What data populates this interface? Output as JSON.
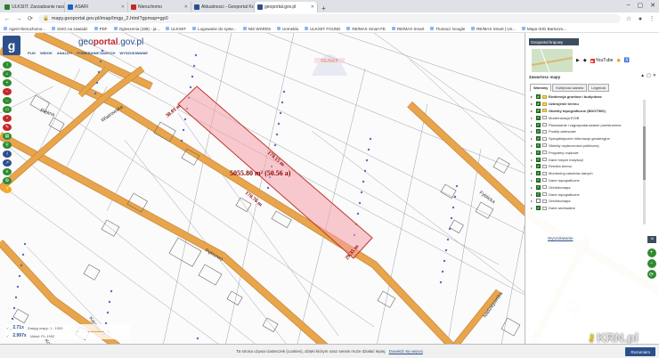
{
  "browser": {
    "tabs": [
      {
        "label": "ULKSIIT. Zarzadzanie narzedzi...",
        "color": "#2e7d32",
        "active": false
      },
      {
        "label": "ASARI",
        "color": "#1565c0",
        "active": false
      },
      {
        "label": "Nieruchomo",
        "color": "#c62828",
        "active": false
      },
      {
        "label": "Aktualnosci - Geoportal Krajowy",
        "color": "#2c4f8c",
        "active": false
      },
      {
        "label": "geoportal.gov.pl",
        "color": "#2c4f8c",
        "active": true
      }
    ],
    "new_tab": "+",
    "window_controls": [
      "–",
      "▢",
      "✕"
    ],
    "url": "mapy.geoportal.gov.pl/imap/Imgp_2.html?gpmap=gp0",
    "bookmarks": [
      "Agent Nieruchomo...",
      "SSIG na zawiadz",
      "PDF",
      "Ogloszenia (198) - ja...",
      "ULKSIIT",
      "Logowanie do syste...",
      "NIS WSRDS",
      "Unmeldu",
      "ULKSIIT FOUND",
      "RE/MAX Smart FE",
      "RE/MAX Smart",
      "Tlumacz Google",
      "RE/MAX Smart | Un...",
      "Mapa ISIG Bartoszu..."
    ]
  },
  "geoportal": {
    "logo_letter": "g",
    "brand_pre": "geo",
    "brand_mid": "portal",
    "brand_post": ".gov.pl",
    "menu": [
      "PLIK",
      "WIDOK",
      "ANALIZY",
      "POBIERANIE DANYCH",
      "WYSZUKIWANIE"
    ],
    "left_tools": [
      {
        "icon": "i-icon",
        "color": "#2e8b2e"
      },
      {
        "icon": "home-icon",
        "color": "#2e8b2e"
      },
      {
        "icon": "zoom-in-icon",
        "color": "#2e8b2e"
      },
      {
        "icon": "zoom-out-icon",
        "color": "#c62828"
      },
      {
        "icon": "ruler-icon",
        "color": "#2e8b2e"
      },
      {
        "icon": "area-icon",
        "color": "#2e8b2e"
      },
      {
        "icon": "pin-icon",
        "color": "#c62828"
      },
      {
        "icon": "draw-icon",
        "color": "#c62828"
      },
      {
        "icon": "print-icon",
        "color": "#2e8b2e"
      },
      {
        "icon": "search-icon",
        "color": "#2e8b2e"
      },
      {
        "icon": "info-icon",
        "color": "#2c4f8c"
      },
      {
        "icon": "share-icon",
        "color": "#2c4f8c"
      },
      {
        "icon": "layers-icon",
        "color": "#2e8b2e"
      },
      {
        "icon": "settings-icon",
        "color": "#2e8b2e"
      },
      {
        "icon": "help-icon",
        "color": "#f9a825"
      }
    ]
  },
  "panel": {
    "title": "Geoportal krajowy",
    "services": [
      "YouTube"
    ],
    "maps_title": "Zawartosc mapy",
    "tabs": [
      "Warstwy",
      "Kolejnosc warstw",
      "Legenda"
    ],
    "layers": [
      {
        "label": "Ewidencja gruntow i budynkow",
        "checked": true,
        "bold": true,
        "folder": true
      },
      {
        "label": "Uzbrojenie terenu",
        "checked": true,
        "bold": true,
        "folder": true
      },
      {
        "label": "Obiekty topograficzne (BDOT500)",
        "checked": true,
        "bold": true,
        "folder": true
      },
      {
        "label": "Modernizacja EGiB",
        "checked": true,
        "bold": false,
        "folder": false
      },
      {
        "label": "Planowanie i zagospodarowanie przestrzenne",
        "checked": true,
        "bold": false,
        "folder": false
      },
      {
        "label": "Punkty adresowe",
        "checked": true,
        "bold": false,
        "folder": false
      },
      {
        "label": "Specjalistyczne informacje geodezyjne",
        "checked": true,
        "bold": false,
        "folder": false
      },
      {
        "label": "Obiekty uzytecznosci publicznej",
        "checked": true,
        "bold": false,
        "folder": false
      },
      {
        "label": "Programy rządowe",
        "checked": true,
        "bold": false,
        "folder": false
      },
      {
        "label": "Dane innych instytucji",
        "checked": true,
        "bold": false,
        "folder": false
      },
      {
        "label": "Rzeźba terenu",
        "checked": true,
        "bold": false,
        "folder": false
      },
      {
        "label": "Monitoring zasobów danych",
        "checked": true,
        "bold": false,
        "folder": false
      },
      {
        "label": "Dane topograficzne",
        "checked": true,
        "bold": false,
        "folder": false
      },
      {
        "label": "Ortofotomapa",
        "checked": true,
        "bold": false,
        "folder": false
      },
      {
        "label": "Dane topograficzne",
        "checked": true,
        "bold": false,
        "folder": false
      },
      {
        "label": "Ortofotomapa",
        "checked": false,
        "bold": false,
        "folder": false
      },
      {
        "label": "Dane archiwalne",
        "checked": true,
        "bold": false,
        "folder": false
      }
    ],
    "bottom_button": "Wyszukiwanie",
    "nav": [
      "+",
      "−",
      "⟳"
    ]
  },
  "map": {
    "streets": [
      "Piękna",
      "Wiatrowska",
      "Pęksowa",
      "Fyblicka",
      "Karasia",
      "Kolacka",
      "Nadziejowska"
    ],
    "plot_area": "5055.80 m² (50.56 a)",
    "dims": [
      "30.01 m",
      "173.15 m",
      "170.76 m",
      "29.35 m"
    ],
    "coords": [
      {
        "value": "2.71x",
        "label": "Zasięg mapy: 1 : 1000"
      },
      {
        "value": "2.997x",
        "label": "Układ: PL-1992"
      }
    ]
  },
  "cookie": {
    "text": "Ta strona używa ciasteczek (cookies), dzięki którym nasz serwis może działać lepiej.",
    "link": "Dowiedz się więcej",
    "button": "Rozumiem"
  },
  "watermark": "KRN.pl"
}
